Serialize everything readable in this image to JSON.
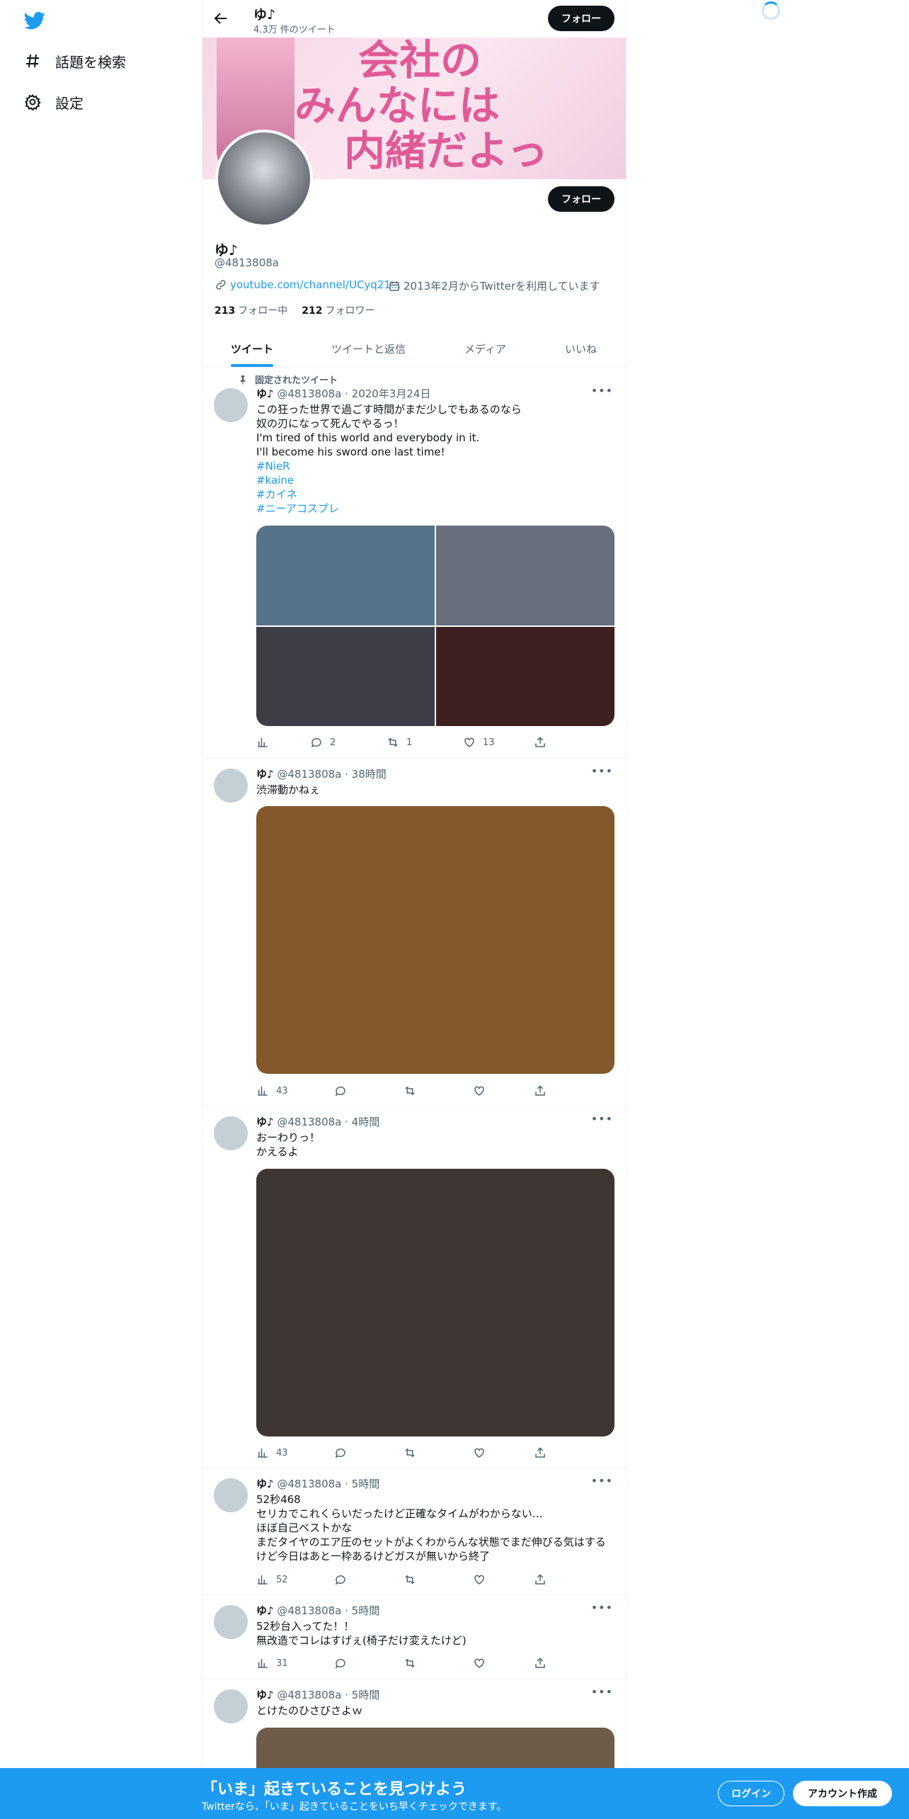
{
  "nav": {
    "explore_label": "話題を検索",
    "settings_label": "設定"
  },
  "header": {
    "name": "ゆ♪",
    "tweet_count": "4.3万 件のツイート",
    "follow_label": "フォロー"
  },
  "banner": {
    "line1": "会社の",
    "line2": "みんなには",
    "line3": "内緒だよっ"
  },
  "profile": {
    "follow_label": "フォロー",
    "name": "ゆ♪",
    "handle": "@4813808a",
    "website": "youtube.com/channel/UCyq21...",
    "joined": "2013年2月からTwitterを利用しています",
    "following_count": "213",
    "following_label": "フォロー中",
    "followers_count": "212",
    "followers_label": "フォロワー"
  },
  "tabs": [
    "ツイート",
    "ツイートと返信",
    "メディア",
    "いいね"
  ],
  "tweets": [
    {
      "pinned_label": "固定されたツイート",
      "name": "ゆ♪",
      "meta": "@4813808a · 2020年3月24日",
      "lines": [
        "この狂った世界で過ごす時間がまだ少しでもあるのなら",
        "奴の刃になって死んでやるっ！",
        "I'm tired of this world and everybody in it.",
        "I'll become his sword one last time!"
      ],
      "hashtags": [
        "#NieR",
        "#kaine",
        "#カイネ",
        "#ニーアコスプレ"
      ],
      "media_colors": [
        "#577389",
        "#676f7f",
        "#3c3d45",
        "#3f2020"
      ],
      "views": "",
      "replies": "2",
      "retweets": "1",
      "likes": "13"
    },
    {
      "name": "ゆ♪",
      "meta": "@4813808a · 38時間",
      "lines": [
        "渋滞動かねぇ"
      ],
      "media_color": "#84582a",
      "views": "43",
      "replies": "",
      "retweets": "",
      "likes": ""
    },
    {
      "name": "ゆ♪",
      "meta": "@4813808a · 4時間",
      "lines": [
        "おーわりっ！",
        "かえるよ"
      ],
      "media_color": "#3e3632",
      "views": "43",
      "replies": "",
      "retweets": "",
      "likes": ""
    },
    {
      "name": "ゆ♪",
      "meta": "@4813808a · 5時間",
      "lines": [
        "52秒468",
        "セリカでこれくらいだったけど正確なタイムがわからない…",
        "ほぼ自己ベストかな",
        "まだタイヤのエア圧のセットがよくわからんな状態でまだ伸びる気はする",
        "けど今日はあと一枠あるけどガスが無いから終了"
      ],
      "views": "52",
      "replies": "",
      "retweets": "",
      "likes": ""
    },
    {
      "name": "ゆ♪",
      "meta": "@4813808a · 5時間",
      "lines": [
        "52秒台入ってた！！",
        "無改造でコレはすげぇ(椅子だけ変えたけど)"
      ],
      "views": "31",
      "replies": "",
      "retweets": "",
      "likes": ""
    },
    {
      "name": "ゆ♪",
      "meta": "@4813808a · 5時間",
      "lines": [
        "とけたのひさびさよｗ"
      ],
      "media_color": "#6e5b4a"
    }
  ],
  "bottom_bar": {
    "title": "「いま」起きていることを見つけよう",
    "subtitle": "Twitterなら、「いま」起きていることをいち早くチェックできます。",
    "login_label": "ログイン",
    "signup_label": "アカウント作成"
  },
  "colors": {
    "accent": "#1d9bf0",
    "text": "#0f1419",
    "secondary": "#536471"
  }
}
